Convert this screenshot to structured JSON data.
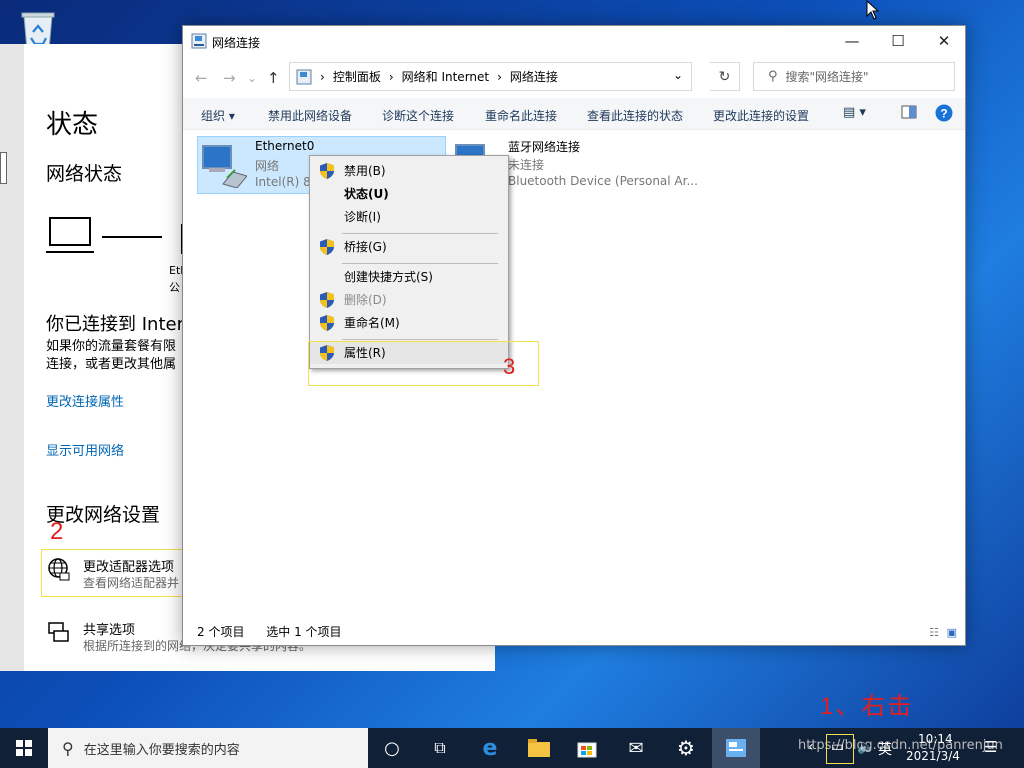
{
  "desktop": {
    "recycle_icon": "recycle-bin-icon"
  },
  "settings": {
    "title": "状态",
    "network_status": "网络状态",
    "adapter_label_1": "Eth",
    "adapter_label_2": "公",
    "connected_heading": "你已连接到 Inter",
    "connected_desc_1": "如果你的流量套餐有限",
    "connected_desc_2": "连接，或者更改其他属",
    "link_change_props": "更改连接属性",
    "link_show_networks": "显示可用网络",
    "change_settings_heading": "更改网络设置",
    "adapter_options_title": "更改适配器选项",
    "adapter_options_desc": "查看网络适配器并",
    "sharing_title": "共享选项",
    "sharing_desc": "根据所连接到的网络，决定要共享的内容。"
  },
  "explorer": {
    "title": "网络连接",
    "breadcrumb": [
      "控制面板",
      "网络和 Internet",
      "网络连接"
    ],
    "search_placeholder": "搜索\"网络连接\"",
    "commands": [
      "组织 ▾",
      "禁用此网络设备",
      "诊断这个连接",
      "重命名此连接",
      "查看此连接的状态",
      "更改此连接的设置"
    ],
    "items": [
      {
        "name": "Ethernet0",
        "line2": "网络",
        "line3": "Intel(R) 82"
      },
      {
        "name": "蓝牙网络连接",
        "line2": "未连接",
        "line3": "Bluetooth Device (Personal Ar..."
      }
    ],
    "status_count": "2 个项目",
    "status_selected": "选中 1 个项目"
  },
  "context_menu": [
    {
      "label": "禁用(B)",
      "shield": true
    },
    {
      "label": "状态(U)",
      "shield": false,
      "bold": true
    },
    {
      "label": "诊断(I)",
      "shield": false
    },
    {
      "label": "桥接(G)",
      "shield": true
    },
    {
      "label": "创建快捷方式(S)",
      "shield": false
    },
    {
      "label": "删除(D)",
      "shield": true,
      "disabled": true
    },
    {
      "label": "重命名(M)",
      "shield": true
    },
    {
      "label": "属性(R)",
      "shield": true
    }
  ],
  "annotations": {
    "step1": "1、右击",
    "step2": "2",
    "step3": "3"
  },
  "taskbar": {
    "search_text": "在这里输入你要搜索的内容",
    "ime": "英",
    "time": "10:14",
    "date": "2021/3/4",
    "watermark": "https://blog.csdn.net/panrenjun"
  },
  "colors": {
    "accent": "#0066b4",
    "annotation": "#e02020",
    "highlight_box": "#f4e04a",
    "taskbar": "#102037"
  }
}
